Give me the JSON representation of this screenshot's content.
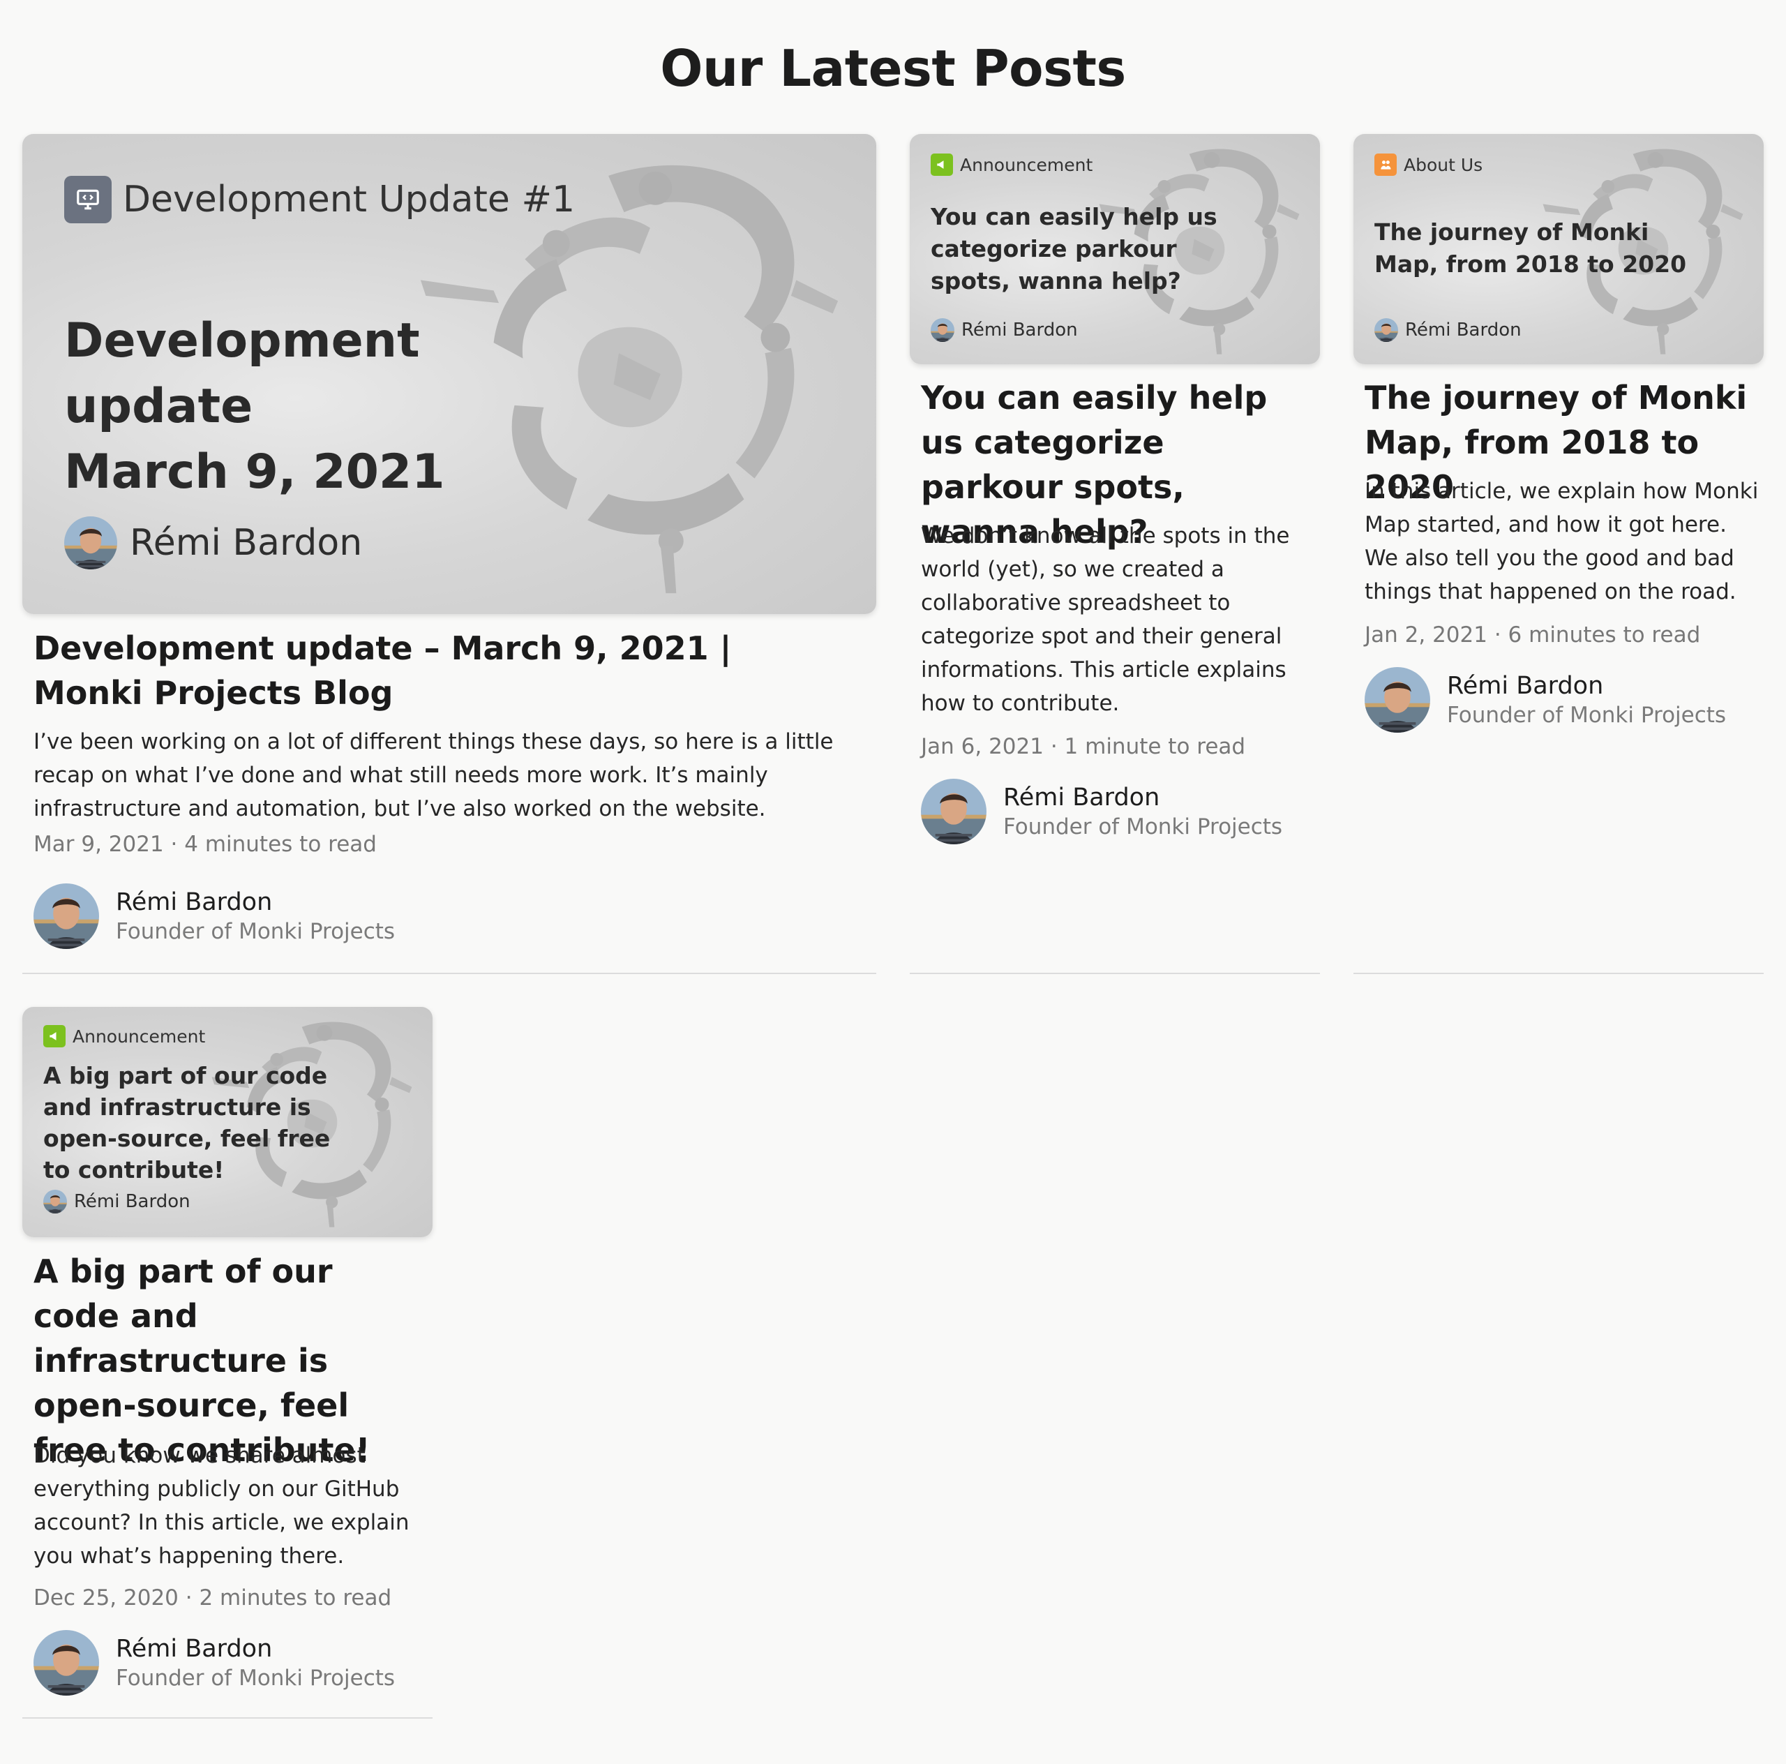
{
  "page": {
    "title": "Our Latest Posts"
  },
  "colors": {
    "background": "#f9f9f8",
    "announcement_tag": "#7cc11f",
    "about_tag": "#f5933b",
    "dev_tag": "#6b7280"
  },
  "posts": [
    {
      "cover": {
        "tag_label": "Development Update #1",
        "tag_icon": "monitor-code-icon",
        "title": "Development update\nMarch 9, 2021",
        "author": "Rémi Bardon"
      },
      "title": "Development update – March 9, 2021 | Monki Projects Blog",
      "excerpt": "I’ve been working on a lot of different things these days, so here is a little recap on what I’ve done and what still needs more work. It’s mainly infrastructure and automation, but I’ve also worked on the website.",
      "date": "Mar 9, 2021",
      "read_time": "4 minutes to read",
      "author": {
        "name": "Rémi Bardon",
        "role": "Founder of Monki Projects"
      }
    },
    {
      "cover": {
        "tag_label": "Announcement",
        "tag_icon": "megaphone-icon",
        "title": "You can easily help us categorize parkour spots, wanna help?",
        "author": "Rémi Bardon"
      },
      "title": "You can easily help us categorize parkour spots, wanna help?",
      "excerpt": "We don’t know all the spots in the world (yet), so we created a collaborative spreadsheet to categorize spot and their general informations. This article explains how to contribute.",
      "date": "Jan 6, 2021",
      "read_time": "1 minute to read",
      "author": {
        "name": "Rémi Bardon",
        "role": "Founder of Monki Projects"
      }
    },
    {
      "cover": {
        "tag_label": "About Us",
        "tag_icon": "people-icon",
        "title": "The journey of Monki Map, from 2018 to 2020",
        "author": "Rémi Bardon"
      },
      "title": "The journey of Monki Map, from 2018 to 2020",
      "excerpt": "In this article, we explain how Monki Map started, and how it got here. We also tell you the good and bad things that happened on the road.",
      "date": "Jan 2, 2021",
      "read_time": "6 minutes to read",
      "author": {
        "name": "Rémi Bardon",
        "role": "Founder of Monki Projects"
      }
    },
    {
      "cover": {
        "tag_label": "Announcement",
        "tag_icon": "megaphone-icon",
        "title": "A big part of our code and infrastructure is open-source, feel free to contribute!",
        "author": "Rémi Bardon"
      },
      "title": "A big part of our code and infrastructure is open-source, feel free to contribute!",
      "excerpt": "Did you know we share almost everything publicly on our GitHub account? In this article, we explain you what’s happening there.",
      "date": "Dec 25, 2020",
      "read_time": "2 minutes to read",
      "author": {
        "name": "Rémi Bardon",
        "role": "Founder of Monki Projects"
      }
    }
  ],
  "meta_separator": "·"
}
